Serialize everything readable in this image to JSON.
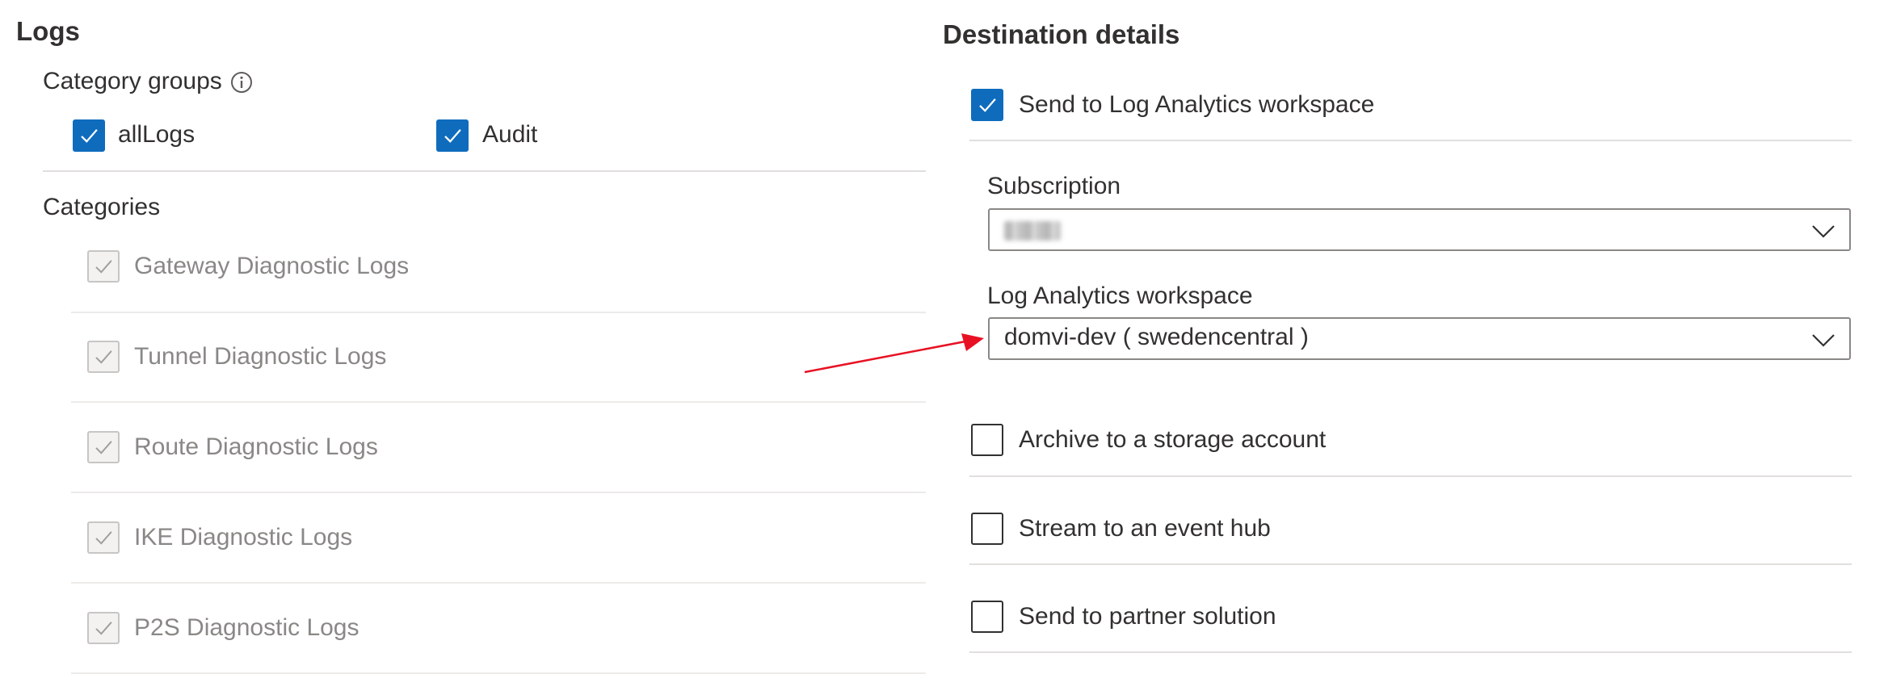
{
  "logs": {
    "title": "Logs",
    "category_groups_label": "Category groups",
    "category_groups": [
      {
        "label": "allLogs",
        "checked": true
      },
      {
        "label": "Audit",
        "checked": true
      }
    ],
    "categories_label": "Categories",
    "categories": [
      {
        "label": "Gateway Diagnostic Logs",
        "checked": true,
        "disabled": true
      },
      {
        "label": "Tunnel Diagnostic Logs",
        "checked": true,
        "disabled": true
      },
      {
        "label": "Route Diagnostic Logs",
        "checked": true,
        "disabled": true
      },
      {
        "label": "IKE Diagnostic Logs",
        "checked": true,
        "disabled": true
      },
      {
        "label": "P2S Diagnostic Logs",
        "checked": true,
        "disabled": true
      }
    ]
  },
  "destination": {
    "title": "Destination details",
    "log_analytics": {
      "label": "Send to Log Analytics workspace",
      "checked": true
    },
    "subscription_label": "Subscription",
    "subscription_value": "",
    "workspace_label": "Log Analytics workspace",
    "workspace_value": "domvi-dev ( swedencentral )",
    "other_options": [
      {
        "label": "Archive to a storage account",
        "checked": false
      },
      {
        "label": "Stream to an event hub",
        "checked": false
      },
      {
        "label": "Send to partner solution",
        "checked": false
      }
    ]
  },
  "colors": {
    "accent": "#0f6cbd",
    "arrow": "#e81123",
    "disabled_text": "#8a8886"
  }
}
